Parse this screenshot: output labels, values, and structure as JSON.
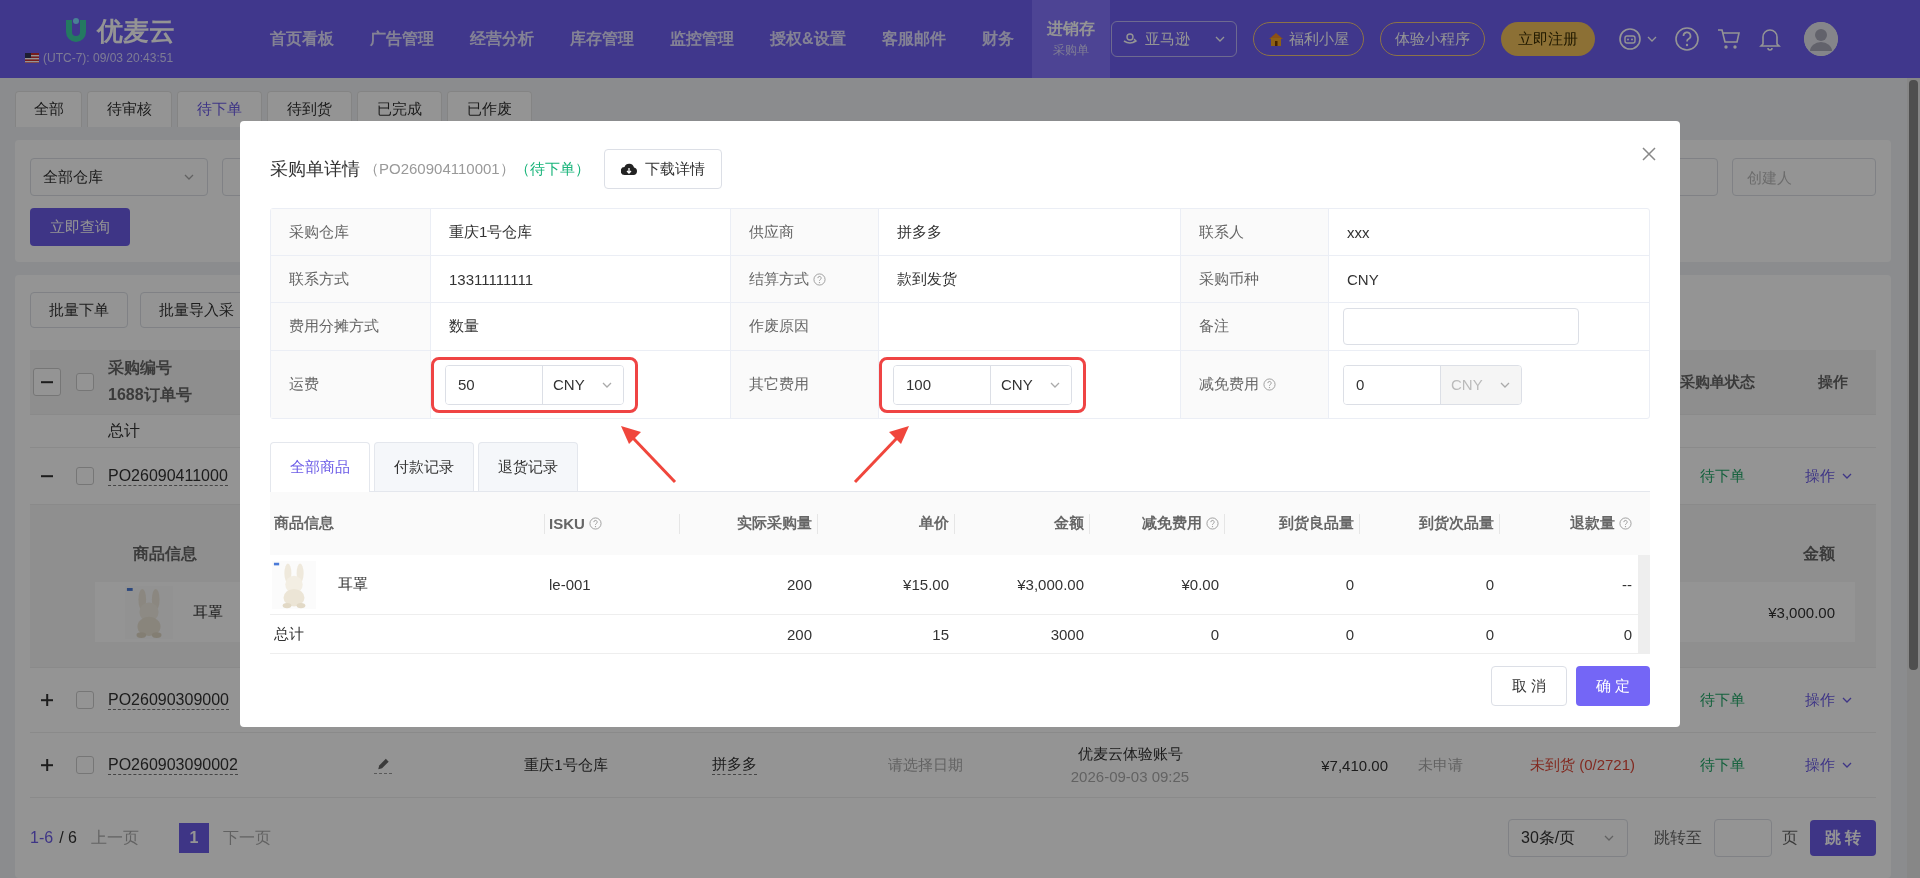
{
  "top_nav": {
    "logo": "优麦云",
    "clock": "(UTC-7): 09/03 20:43:51",
    "menu": [
      {
        "label": "首页看板",
        "selected": false
      },
      {
        "label": "广告管理",
        "selected": false
      },
      {
        "label": "经营分析",
        "selected": false
      },
      {
        "label": "库存管理",
        "selected": false
      },
      {
        "label": "监控管理",
        "selected": false
      },
      {
        "label": "授权&设置",
        "selected": false
      },
      {
        "label": "客服邮件",
        "selected": false
      },
      {
        "label": "财务",
        "selected": false
      },
      {
        "label": "进销存",
        "sub": "采购单",
        "selected": true
      }
    ],
    "marketplace": "亚马逊",
    "pills": [
      {
        "label": "福利小屋",
        "kind": "gift"
      },
      {
        "label": "体验小程序",
        "kind": "outline"
      },
      {
        "label": "立即注册",
        "kind": "gold"
      }
    ]
  },
  "status_tabs": [
    {
      "label": "全部",
      "selected": false
    },
    {
      "label": "待审核",
      "selected": false
    },
    {
      "label": "待下单",
      "selected": true
    },
    {
      "label": "待到货",
      "selected": false
    },
    {
      "label": "已完成",
      "selected": false
    },
    {
      "label": "已作废",
      "selected": false
    }
  ],
  "filters": {
    "warehouse": "全部仓库",
    "creator": {
      "placeholder": "创建人"
    },
    "query_button": "立即查询"
  },
  "actions": [
    "批量下单",
    "批量导入采"
  ],
  "orders_table": {
    "header": {
      "expanded": true,
      "checked": false,
      "order_no": "采购编号",
      "alibaba_no": "1688订单号",
      "status": "采购单状态",
      "ops": "操作"
    },
    "total_label": "总计",
    "rows": [
      {
        "expanded": true,
        "checked": false,
        "order_no": "PO26090411000",
        "status": "待下单",
        "ops": "操作",
        "detail": {
          "product_header": "商品信息",
          "amount_header": "金额",
          "product": "耳罩",
          "amount": "¥3,000.00"
        }
      },
      {
        "expanded": false,
        "checked": false,
        "order_no": "PO26090309000",
        "status": "待下单",
        "ops": "操作"
      },
      {
        "expanded": false,
        "checked": false,
        "order_no": "PO260903090002",
        "warehouse": "重庆1号仓库",
        "supplier": "拼多多",
        "date": {
          "placeholder": "请选择日期"
        },
        "creator": "优麦云体验账号",
        "created": "2026-09-03 09:25",
        "total": "¥7,410.00",
        "payment": "未申请",
        "arrival": "未到货 (0/2721)",
        "status": "待下单",
        "ops": "操作"
      }
    ]
  },
  "pagination": {
    "range": "1-6",
    "total": "/ 6",
    "prev": "上一页",
    "pages": [
      {
        "label": "1",
        "selected": true
      }
    ],
    "next": "下一页",
    "page_size": "30条/页",
    "jump_label": "跳转至",
    "page_unit": "页",
    "jump_button": "跳 转"
  },
  "modal": {
    "title": "采购单详情",
    "order_no": "（PO260904110001）",
    "status": "（待下单）",
    "download": "下载详情",
    "info": [
      {
        "label": "采购仓库",
        "help": false,
        "kind": "text",
        "value": "重庆1号仓库"
      },
      {
        "label": "供应商",
        "help": false,
        "kind": "text",
        "value": "拼多多"
      },
      {
        "label": "联系人",
        "help": false,
        "kind": "text",
        "value": "xxx"
      },
      {
        "label": "联系方式",
        "help": false,
        "kind": "text",
        "value": "13311111111"
      },
      {
        "label": "结算方式",
        "help": true,
        "kind": "text",
        "value": "款到发货"
      },
      {
        "label": "采购币种",
        "help": false,
        "kind": "text",
        "value": "CNY"
      },
      {
        "label": "费用分摊方式",
        "help": false,
        "kind": "text",
        "value": "数量"
      },
      {
        "label": "作废原因",
        "help": false,
        "kind": "text"
      },
      {
        "label": "备注",
        "help": false,
        "kind": "input"
      },
      {
        "label": "运费",
        "help": false,
        "kind": "money",
        "value": "50",
        "currency": "CNY",
        "disabled": false,
        "highlighted": true
      },
      {
        "label": "其它费用",
        "help": false,
        "kind": "money",
        "value": "100",
        "currency": "CNY",
        "disabled": false,
        "highlighted": true
      },
      {
        "label": "减免费用",
        "help": true,
        "kind": "money",
        "value": "0",
        "currency": "CNY",
        "disabled": true,
        "highlighted": false
      }
    ],
    "tabs": [
      {
        "label": "全部商品",
        "selected": true
      },
      {
        "label": "付款记录",
        "selected": false
      },
      {
        "label": "退货记录",
        "selected": false
      }
    ],
    "items_table": {
      "columns": [
        {
          "label": "商品信息",
          "help": false
        },
        {
          "label": "ISKU",
          "help": true
        },
        {
          "label": "实际采购量",
          "help": false
        },
        {
          "label": "单价",
          "help": false
        },
        {
          "label": "金额",
          "help": false
        },
        {
          "label": "减免费用",
          "help": true
        },
        {
          "label": "到货良品量",
          "help": false
        },
        {
          "label": "到货次品量",
          "help": false
        },
        {
          "label": "退款量",
          "help": true
        }
      ],
      "rows": [
        {
          "kind": "product",
          "cells": [
            "耳罩",
            "le-001",
            "200",
            "¥15.00",
            "¥3,000.00",
            "¥0.00",
            "0",
            "0",
            "--"
          ]
        },
        {
          "kind": "total",
          "cells": [
            "总计",
            null,
            "200",
            "15",
            "3000",
            "0",
            "0",
            "0",
            "0"
          ]
        }
      ]
    },
    "cancel": "取 消",
    "confirm": "确 定"
  }
}
